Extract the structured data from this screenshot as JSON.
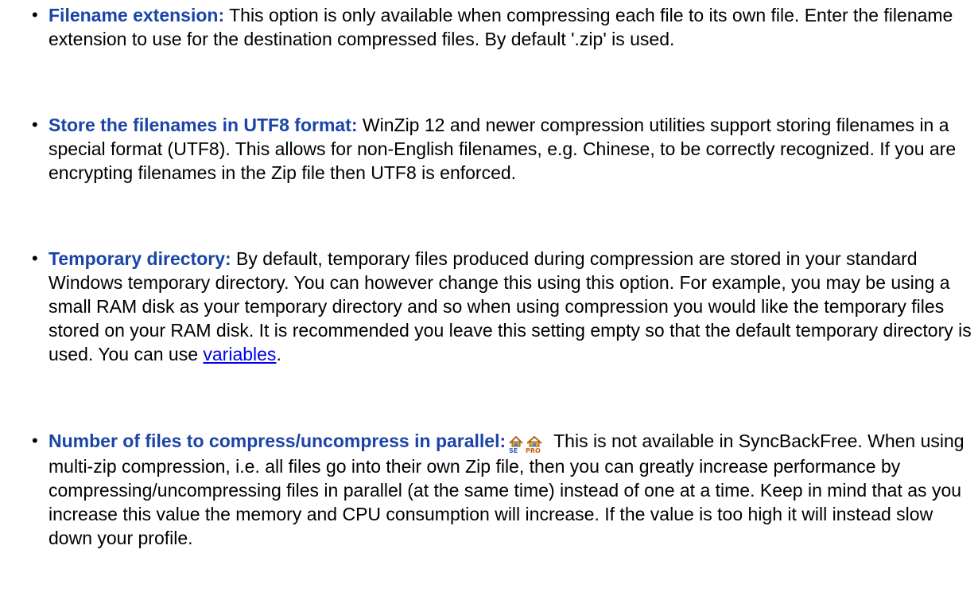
{
  "options": [
    {
      "term": "Filename extension:",
      "text": " This option is only available when compressing each file to its own file. Enter the filename extension to use for the destination compressed files. By default '.zip' is used."
    },
    {
      "term": "Store the filenames in UTF8 format:",
      "text": " WinZip 12 and newer compression utilities support storing filenames in a special format (UTF8). This allows for non-English filenames, e.g. Chinese, to be correctly recognized. If you are encrypting filenames in the Zip file then UTF8 is enforced."
    },
    {
      "term": "Temporary directory:",
      "text": " By default, temporary files produced during compression are stored in your standard Windows temporary directory. You can however change this using this option. For example, you may be using a small RAM disk as your temporary directory and so when using compression you would like the temporary files stored on your RAM disk. It is recommended you leave this setting empty so that the default temporary directory is used. You can use ",
      "link": "variables",
      "after": "."
    },
    {
      "term": "Number of files to compress/uncompress in parallel:",
      "icons": [
        "syncback-se-icon",
        "syncback-pro-icon"
      ],
      "text": " This is not available in SyncBackFree. When using multi-zip compression, i.e. all files go into their own Zip file, then you can greatly increase performance by compressing/uncompressing files in parallel (at the same time) instead of one at a time. Keep in mind that as you increase this value the memory and CPU consumption will increase. If the value is too high it will instead slow down your profile."
    }
  ],
  "colors": {
    "term": "#1a44a8",
    "link": "#0000ee",
    "text": "#000000"
  }
}
